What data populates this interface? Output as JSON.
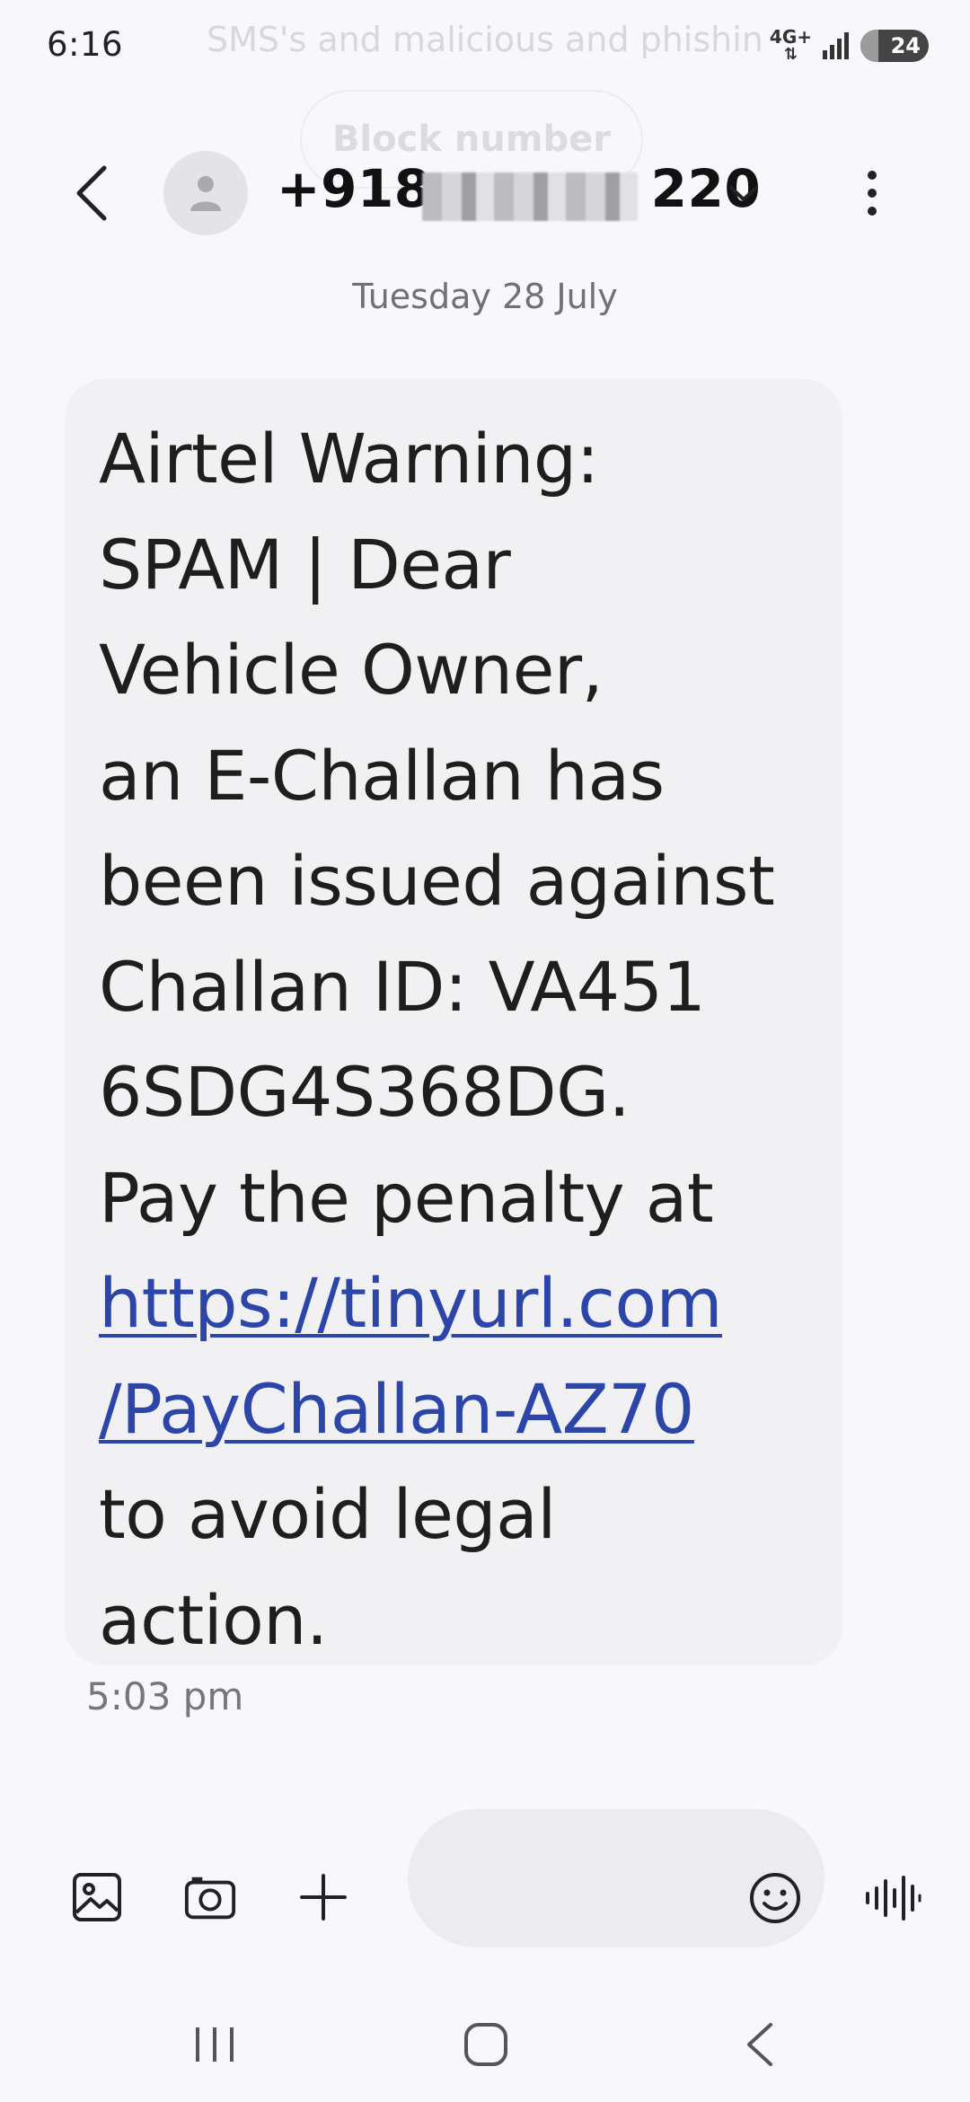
{
  "status_bar": {
    "time": "6:16",
    "network": "4G+",
    "battery": "24",
    "ghost_notification": "SMS's and malicious and phishing"
  },
  "ghost_overlay": {
    "block_label": "Block number"
  },
  "header": {
    "contact_prefix": "+918",
    "contact_suffix": "220",
    "contact_redacted": true
  },
  "conversation": {
    "date_separator": "Tuesday 28 July",
    "message": {
      "lines": [
        "Airtel Warning:",
        "SPAM | Dear",
        "Vehicle Owner,",
        "an E-Challan has",
        "been issued against",
        "Challan ID: VA451",
        "6SDG4S368DG.",
        "Pay the penalty at"
      ],
      "link_lines": [
        "https://tinyurl.com",
        "/PayChallan-AZ70"
      ],
      "tail_lines": [
        "to avoid legal",
        "action."
      ],
      "time": "5:03 pm"
    }
  },
  "composer": {
    "icons": [
      "gallery-icon",
      "camera-icon",
      "plus-icon",
      "emoji-icon",
      "voice-icon"
    ]
  },
  "colors": {
    "background": "#f8f7fb",
    "bubble": "#f1f1f3",
    "link": "#2b45a8"
  }
}
